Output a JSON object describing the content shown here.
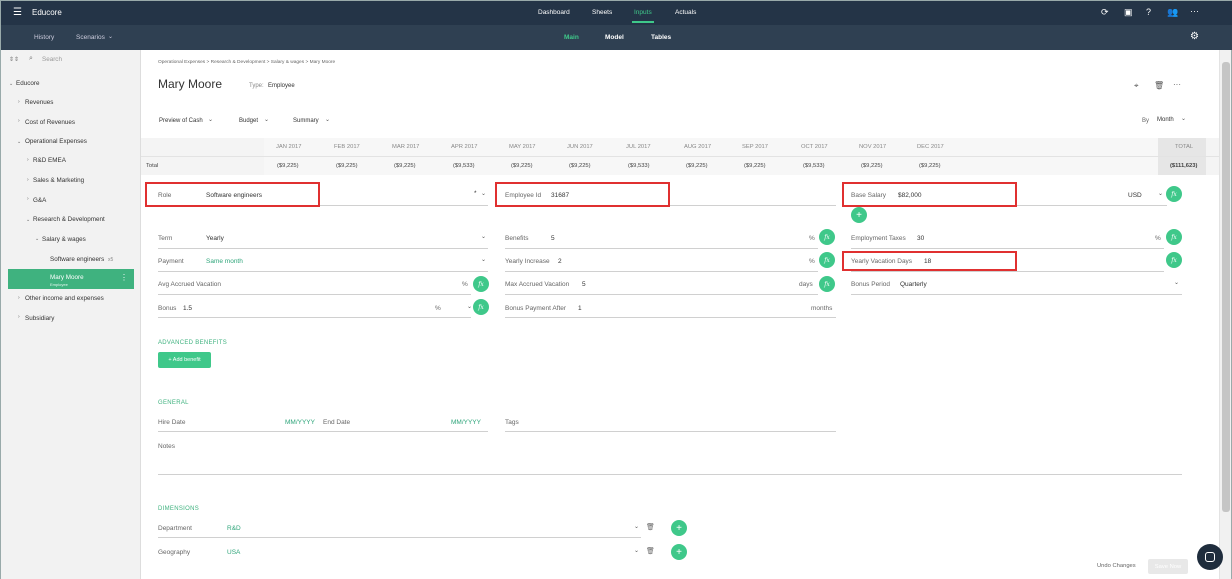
{
  "app": {
    "title": "Educore",
    "menu_icon": "hamburger-icon"
  },
  "top_nav": [
    "Dashboard",
    "Sheets",
    "Inputs",
    "Actuals"
  ],
  "top_nav_active": "Inputs",
  "sub_left": {
    "history": "History",
    "scenarios": "Scenarios"
  },
  "sub_tabs": [
    "Main",
    "Model",
    "Tables"
  ],
  "sidebar": {
    "search_placeholder": "Search",
    "items": [
      {
        "label": "Educore"
      },
      {
        "label": "Revenues"
      },
      {
        "label": "Cost of Revenues"
      },
      {
        "label": "Operational Expenses"
      },
      {
        "label": "R&D EMEA"
      },
      {
        "label": "Sales & Marketing"
      },
      {
        "label": "G&A"
      },
      {
        "label": "Research & Development"
      },
      {
        "label": "Salary & wages"
      },
      {
        "label": "Software engineers",
        "badge": "x5"
      },
      {
        "label": "Mary Moore",
        "sub": "Employee"
      },
      {
        "label": "Other income and expenses"
      },
      {
        "label": "Subsidiary"
      }
    ]
  },
  "breadcrumb": "Operational Expenses > Research & Development > Salary & wages > Mary Moore",
  "employee": {
    "name": "Mary Moore",
    "type_label": "Type:",
    "type_value": "Employee"
  },
  "toolbar": {
    "preview": "Preview of Cash",
    "budget": "Budget",
    "summary": "Summary",
    "by_label": "By",
    "by_value": "Month"
  },
  "grid": {
    "months": [
      "JAN 2017",
      "FEB 2017",
      "MAR 2017",
      "APR 2017",
      "MAY 2017",
      "JUN 2017",
      "JUL 2017",
      "AUG 2017",
      "SEP 2017",
      "OCT 2017",
      "NOV 2017",
      "DEC 2017"
    ],
    "total_header": "TOTAL",
    "row_label": "Total",
    "amounts": [
      "($9,225)",
      "($9,225)",
      "($9,225)",
      "($9,533)",
      "($9,225)",
      "($9,225)",
      "($9,533)",
      "($9,225)",
      "($9,225)",
      "($9,533)",
      "($9,225)",
      "($9,225)"
    ],
    "total": "($111,623)"
  },
  "fields": {
    "role_label": "Role",
    "role_value": "Software engineers",
    "role_required": "*",
    "employee_id_label": "Employee Id",
    "employee_id_value": "31687",
    "base_salary_label": "Base Salary",
    "base_salary_value": "$82,000",
    "currency": "USD",
    "term_label": "Term",
    "term_value": "Yearly",
    "benefits_label": "Benefits",
    "benefits_value": "5",
    "pct": "%",
    "emp_taxes_label": "Employment Taxes",
    "emp_taxes_value": "30",
    "payment_label": "Payment",
    "payment_value": "Same month",
    "yearly_increase_label": "Yearly Increase",
    "yearly_increase_value": "2",
    "vacation_days_label": "Yearly Vacation Days",
    "vacation_days_value": "18",
    "avg_vacation_label": "Avg Accrued Vacation",
    "max_vacation_label": "Max Accrued Vacation",
    "max_vacation_value": "5",
    "days": "days",
    "bonus_period_label": "Bonus Period",
    "bonus_period_value": "Quarterly",
    "bonus_label": "Bonus",
    "bonus_value": "1.5",
    "bonus_after_label": "Bonus Payment After",
    "bonus_after_value": "1",
    "months": "months"
  },
  "advanced": {
    "title": "ADVANCED BENEFITS",
    "add_button": "+ Add benefit"
  },
  "general": {
    "title": "GENERAL",
    "hire_label": "Hire Date",
    "hire_value": "MM/YYYY",
    "end_label": "End Date",
    "end_value": "MM/YYYY",
    "tags_label": "Tags",
    "notes_label": "Notes"
  },
  "dimensions": {
    "title": "DIMENSIONS",
    "department_label": "Department",
    "department_value": "R&D",
    "geography_label": "Geography",
    "geography_value": "USA"
  },
  "footer": {
    "undo": "Undo Changes",
    "save": "Save Now"
  },
  "colors": {
    "accent": "#3fc88a",
    "topbar": "#243447",
    "highlight": "#e03030"
  }
}
